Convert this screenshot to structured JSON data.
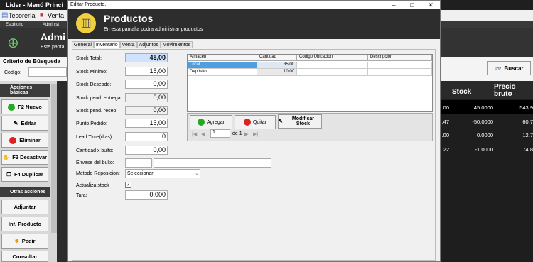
{
  "app": {
    "title": "Lider - Menú Princi",
    "menu": [
      "Tesorería",
      "Venta"
    ],
    "tabs": [
      "Escritorio",
      "Administ"
    ],
    "header_title": "Admi",
    "header_sub": "Este panta"
  },
  "criteria": {
    "label": "Criterio de Búsqueda",
    "codigo_label": "Codigo:",
    "search_button": "Buscar"
  },
  "left": {
    "section1": "Acciones básicas",
    "buttons1": [
      "F2 Nuevo",
      "Editar",
      "Eliminar",
      "F3 Desactivar",
      "F4 Duplicar"
    ],
    "section2": "Otras acciones",
    "buttons2": [
      "Adjuntar",
      "Inf. Producto",
      "Pedir",
      "Consultar"
    ]
  },
  "bggrid": {
    "headers": [
      "Stock",
      "Precio bruto"
    ],
    "rows": [
      [
        ".00",
        "45.0000",
        "543.9"
      ],
      [
        ".47",
        "-50.0000",
        "60.7"
      ],
      [
        ".00",
        "0.0000",
        "12.7"
      ],
      [
        ".22",
        "-1.0000",
        "74.8"
      ]
    ]
  },
  "dialog": {
    "window_title": "Editar Producto.",
    "title": "Productos",
    "subtitle": "En esta pantalla podra administrar productos",
    "tabs": [
      "General",
      "Inventario",
      "Venta",
      "Adjuntos",
      "Movimientos"
    ],
    "fields": [
      {
        "label": "Stock Total:",
        "value": "45,00"
      },
      {
        "label": "Stock Minimo:",
        "value": "15,00"
      },
      {
        "label": "Stock Deseado:",
        "value": "0,00"
      },
      {
        "label": "Stock pend. entrega:",
        "value": "0,00"
      },
      {
        "label": "Stock pend. recep:",
        "value": "0,00"
      },
      {
        "label": "Punto Pedido:",
        "value": "15,00"
      },
      {
        "label": "Lead Time(dias):",
        "value": "0"
      },
      {
        "label": "Cantidad x bulto:",
        "value": "0,00"
      }
    ],
    "envase_label": "Envase del bulto:",
    "metodo_label": "Metodo Reposicion:",
    "metodo_value": "Seleccionar",
    "actualiza_label": "Actualiza stock",
    "tara_label": "Tara:",
    "tara_value": "0,000",
    "grid_headers": [
      "Almacen",
      "Cantidad",
      "Codigo Ubicacion",
      "Descripcion"
    ],
    "grid_rows": [
      [
        "Local",
        "35.00",
        "",
        ""
      ],
      [
        "Depósito",
        "10.00",
        "",
        ""
      ]
    ],
    "btn_agregar": "Agregar",
    "btn_quitar": "Quitar",
    "btn_modificar": "Modificar Stock",
    "pager_page": "1",
    "pager_of": "de 1"
  }
}
